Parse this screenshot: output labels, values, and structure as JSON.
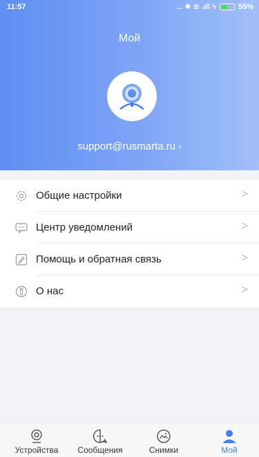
{
  "status_bar": {
    "time": "11:57",
    "indicators": "... ✱ ≋ .ıll ϟ",
    "battery": "55%",
    "battery_level": 0.55
  },
  "header": {
    "title": "Мой",
    "account": "support@rusmarta.ru",
    "account_chevron": "›"
  },
  "menu": [
    {
      "label": "Общие настройки",
      "icon": "gear-icon"
    },
    {
      "label": "Центр уведомлений",
      "icon": "message-icon"
    },
    {
      "label": "Помощь и обратная связь",
      "icon": "edit-icon"
    },
    {
      "label": "О нас",
      "icon": "info-icon"
    }
  ],
  "menu_chevron": ">",
  "tabs": [
    {
      "label": "Устройства",
      "icon": "camera-icon"
    },
    {
      "label": "Сообщения",
      "icon": "chat-icon"
    },
    {
      "label": "Снимки",
      "icon": "photo-icon"
    },
    {
      "label": "Мой",
      "icon": "person-icon",
      "active": true
    }
  ],
  "colors": {
    "accent": "#4a7df0",
    "header_start": "#5f8ff3",
    "header_end": "#a2bff9"
  }
}
